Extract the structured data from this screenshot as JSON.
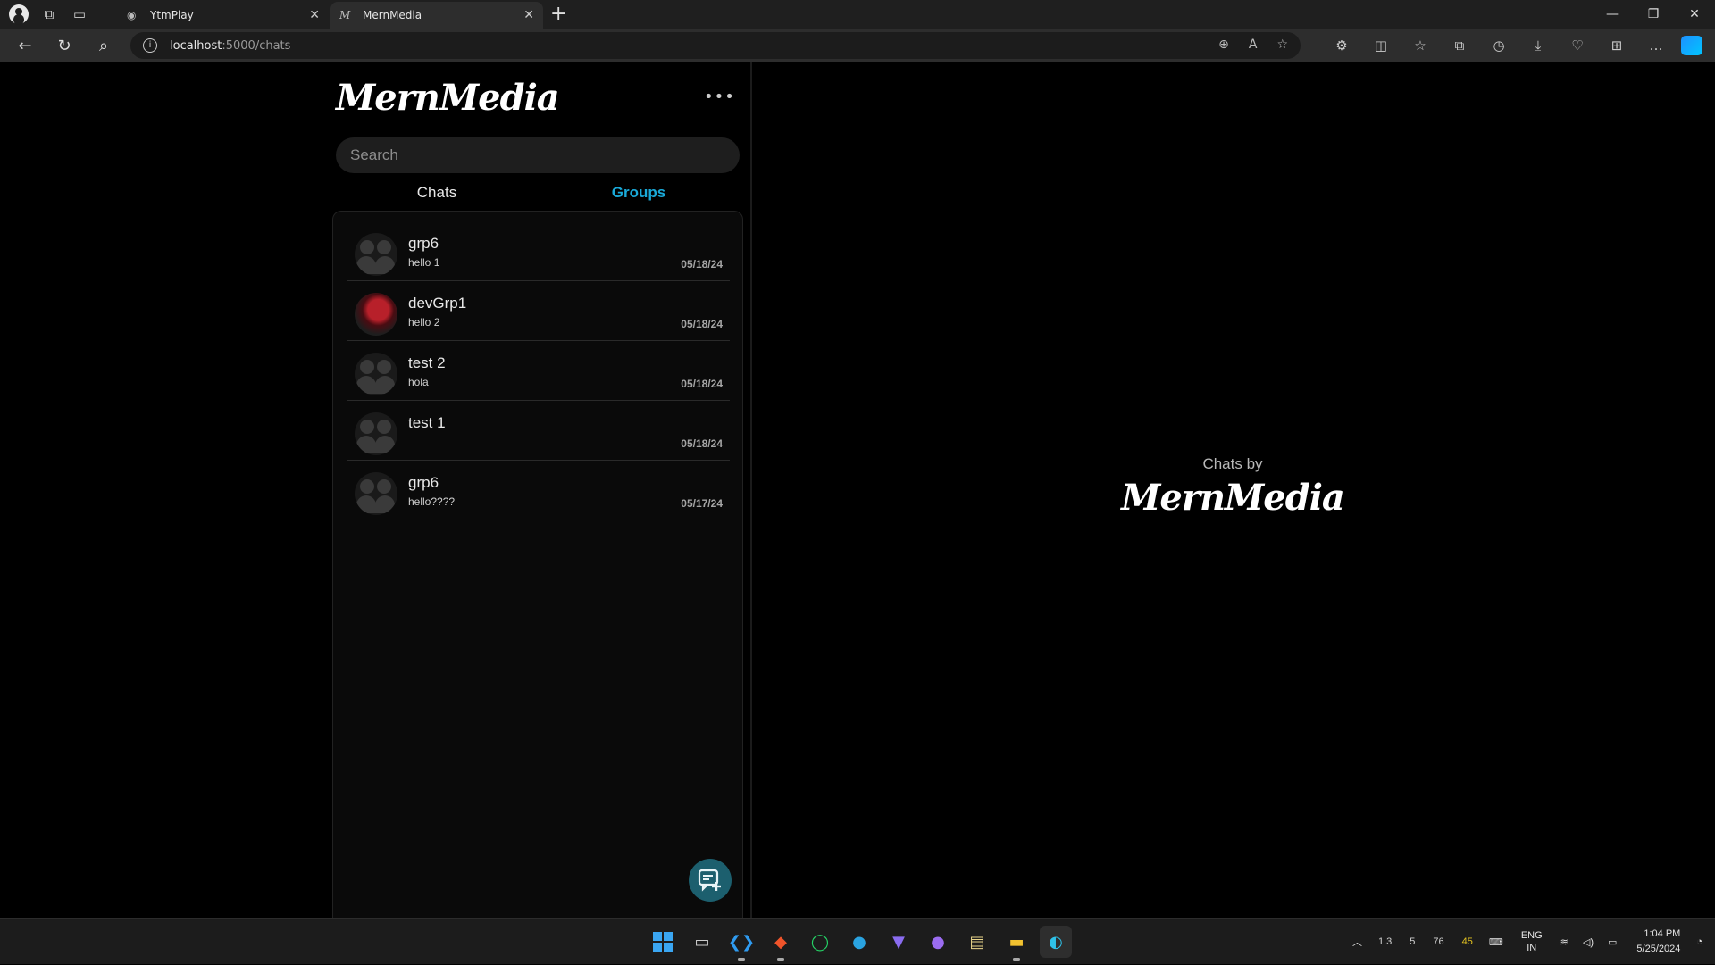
{
  "browser": {
    "tabs": [
      {
        "title": "YtmPlay",
        "active": false
      },
      {
        "title": "MernMedia",
        "active": true
      }
    ],
    "url_host": "localhost",
    "url_path": ":5000/chats"
  },
  "app": {
    "brand": "MernMedia",
    "search_placeholder": "Search",
    "tabs": {
      "chats": "Chats",
      "groups": "Groups",
      "active": "groups"
    },
    "groups": [
      {
        "name": "grp6",
        "last_message": "hello 1",
        "date": "05/18/24",
        "avatar": "default-group-icon"
      },
      {
        "name": "devGrp1",
        "last_message": "hello 2",
        "date": "05/18/24",
        "avatar": "custom-photo"
      },
      {
        "name": "test 2",
        "last_message": "hola",
        "date": "05/18/24",
        "avatar": "default-group-icon"
      },
      {
        "name": "test 1",
        "last_message": "",
        "date": "05/18/24",
        "avatar": "default-group-icon"
      },
      {
        "name": "grp6",
        "last_message": "hello????",
        "date": "05/17/24",
        "avatar": "default-group-icon"
      }
    ],
    "welcome": {
      "by": "Chats by",
      "brand": "MernMedia"
    },
    "accent": "#1aa9d8",
    "fab_color": "#1c5f6e"
  },
  "taskbar": {
    "tray_numbers": [
      "1.3",
      "5",
      "76",
      "45"
    ],
    "lang": [
      "ENG",
      "IN"
    ],
    "time": "1:04 PM",
    "date": "5/25/2024"
  }
}
